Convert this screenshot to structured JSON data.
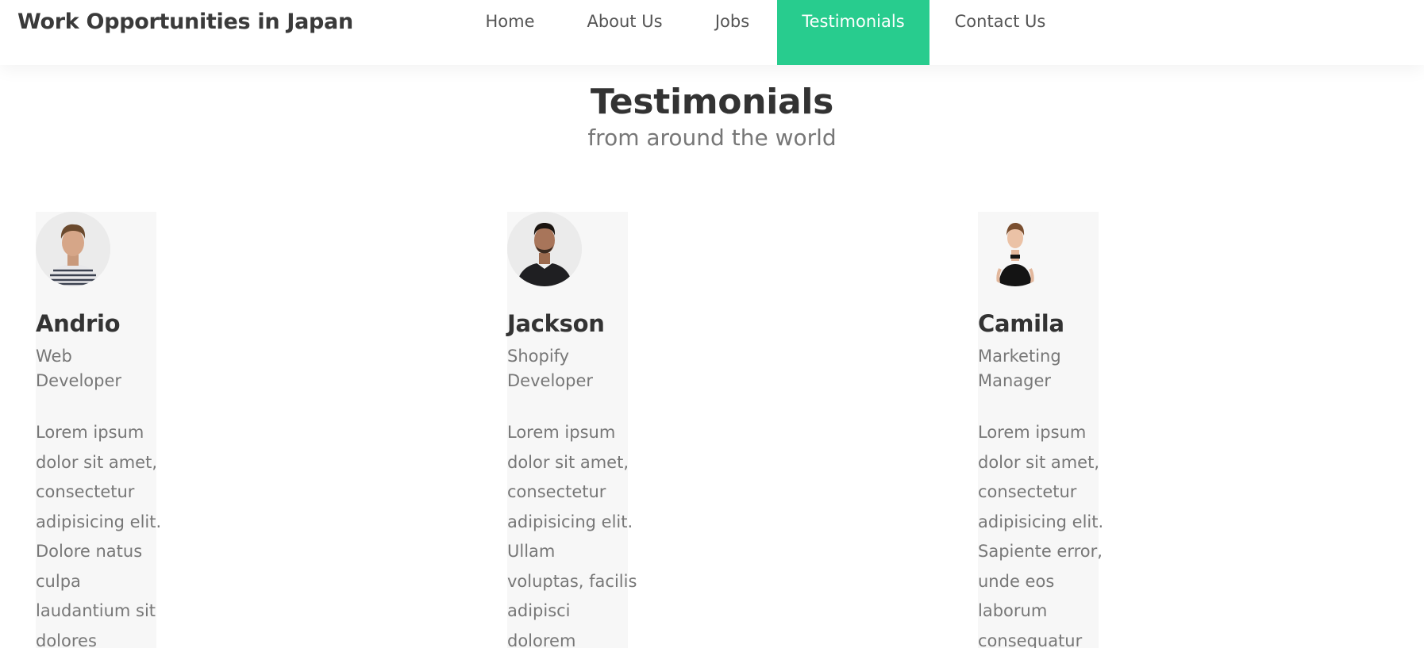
{
  "brand": "Work Opportunities in Japan",
  "nav": {
    "items": [
      {
        "label": "Home",
        "active": false
      },
      {
        "label": "About Us",
        "active": false
      },
      {
        "label": "Jobs",
        "active": false
      },
      {
        "label": "Testimonials",
        "active": true
      },
      {
        "label": "Contact Us",
        "active": false
      }
    ]
  },
  "colors": {
    "accent": "#28cc8e",
    "card_bg": "#f7f7f7",
    "text_dark": "#333333",
    "text_muted": "#777777"
  },
  "section": {
    "title": "Testimonials",
    "subtitle": "from around the world"
  },
  "testimonials": [
    {
      "name": "Andrio",
      "role_lines": [
        "Web",
        "Developer"
      ],
      "quote_lines": [
        "Lorem ipsum",
        "dolor sit amet,",
        "consectetur",
        "adipisicing elit.",
        "Dolore natus",
        "culpa",
        "laudantium sit",
        "dolores"
      ],
      "avatar_icon": "person-striped-shirt-avatar"
    },
    {
      "name": "Jackson",
      "role_lines": [
        "Shopify",
        "Developer"
      ],
      "quote_lines": [
        "Lorem ipsum",
        "dolor sit amet,",
        "consectetur",
        "adipisicing elit.",
        "Ullam",
        "voluptas, facilis",
        "adipisci",
        "dolorem"
      ],
      "avatar_icon": "person-black-sweater-avatar"
    },
    {
      "name": "Camila",
      "role_lines": [
        "Marketing",
        "Manager"
      ],
      "quote_lines": [
        "Lorem ipsum",
        "dolor sit amet,",
        "consectetur",
        "adipisicing elit.",
        "Sapiente error,",
        "unde eos",
        "laborum",
        "consequatur"
      ],
      "avatar_icon": "person-black-top-avatar"
    }
  ]
}
